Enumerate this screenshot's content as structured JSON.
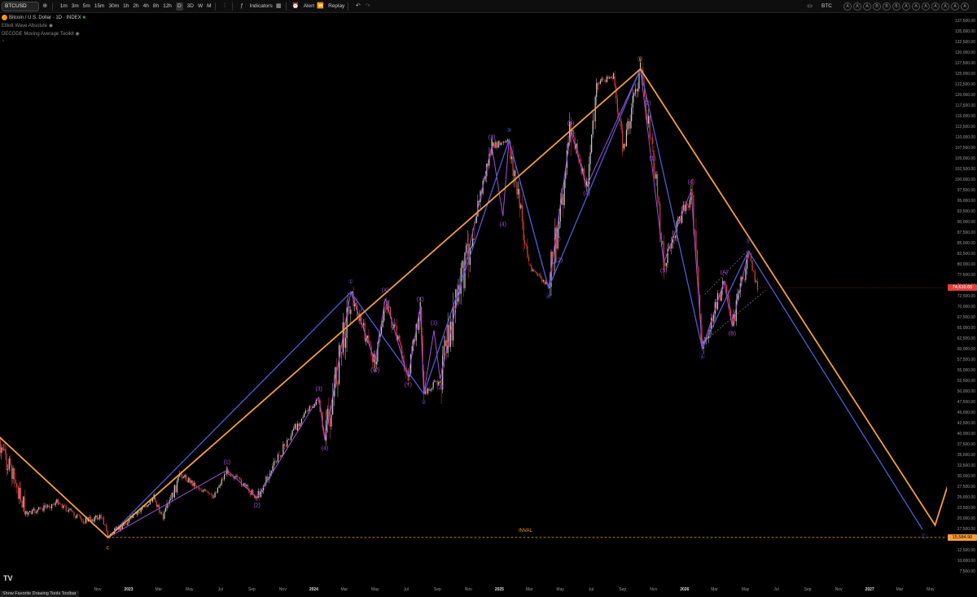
{
  "toolbar": {
    "symbol": "BTCUSD",
    "timeframes": [
      "1m",
      "3m",
      "5m",
      "15m",
      "30m",
      "1h",
      "2h",
      "4h",
      "8h",
      "12h",
      "D",
      "3D",
      "W",
      "M"
    ],
    "active_timeframe": "D",
    "indicators_label": "Indicators",
    "alert_label": "Alert",
    "replay_label": "Replay",
    "right_symbol": "BTC",
    "right_circles": [
      "A",
      "A",
      "A",
      "B",
      "B",
      "B",
      "A",
      "A",
      "A",
      "A",
      "A",
      "A",
      "A"
    ]
  },
  "legend": {
    "title": "Bitcoin / U.S. Dollar · 1D · INDEX",
    "line1": "Elliott Wave Absolute",
    "line2": "DECODE Moving Average Toolkit"
  },
  "colors": {
    "orange": "#f59e3b",
    "blue": "#4f5bd5",
    "purple": "#a64fd8",
    "up_candle": "#c8c8c8",
    "down_candle": "#e0413c",
    "current_price_bg": "#e0413c",
    "inval_bg": "#f59e3b"
  },
  "annotations": {
    "inval_label": "INVAL",
    "current_price": "74,610.66",
    "inval_price": "15,584.90",
    "status_text": "Show Favorite Drawing Tools Toolbar"
  },
  "chart_data": {
    "type": "line",
    "title": "Bitcoin / U.S. Dollar · 1D · INDEX",
    "xlabel": "",
    "ylabel": "",
    "ylim": [
      5000,
      140000
    ],
    "y_ticks": [
      7500,
      10000,
      12500,
      15000,
      17500,
      20000,
      22500,
      25000,
      27500,
      30000,
      32500,
      35000,
      37500,
      40000,
      42500,
      45000,
      47500,
      50000,
      52500,
      55000,
      57500,
      60000,
      62500,
      65000,
      67500,
      70000,
      72500,
      75000,
      77500,
      80000,
      82500,
      85000,
      87500,
      90000,
      92500,
      95000,
      97500,
      100000,
      102500,
      105000,
      107500,
      110000,
      112500,
      115000,
      117500,
      120000,
      122500,
      125000,
      127500,
      130000,
      132500,
      135000,
      137500
    ],
    "x_ticks": [
      {
        "date": "2022-11-01",
        "label": "Nov"
      },
      {
        "date": "2023-01-01",
        "label": "2023"
      },
      {
        "date": "2023-03-01",
        "label": "Mar"
      },
      {
        "date": "2023-05-01",
        "label": "May"
      },
      {
        "date": "2023-07-01",
        "label": "Jul"
      },
      {
        "date": "2023-09-01",
        "label": "Sep"
      },
      {
        "date": "2023-11-01",
        "label": "Nov"
      },
      {
        "date": "2024-01-01",
        "label": "2024"
      },
      {
        "date": "2024-03-01",
        "label": "Mar"
      },
      {
        "date": "2024-05-01",
        "label": "May"
      },
      {
        "date": "2024-07-01",
        "label": "Jul"
      },
      {
        "date": "2024-09-01",
        "label": "Sep"
      },
      {
        "date": "2024-11-01",
        "label": "Nov"
      },
      {
        "date": "2025-01-01",
        "label": "2025"
      },
      {
        "date": "2025-03-01",
        "label": "Mar"
      },
      {
        "date": "2025-05-01",
        "label": "May"
      },
      {
        "date": "2025-07-01",
        "label": "Jul"
      },
      {
        "date": "2025-09-01",
        "label": "Sep"
      },
      {
        "date": "2025-11-01",
        "label": "Nov"
      },
      {
        "date": "2026-01-01",
        "label": "2026"
      },
      {
        "date": "2026-03-01",
        "label": "Mar"
      },
      {
        "date": "2026-05-01",
        "label": "May"
      },
      {
        "date": "2026-07-01",
        "label": "Jul"
      },
      {
        "date": "2026-09-01",
        "label": "Sep"
      },
      {
        "date": "2026-11-01",
        "label": "Nov"
      },
      {
        "date": "2027-01-01",
        "label": "2027"
      },
      {
        "date": "2027-03-01",
        "label": "Mar"
      },
      {
        "date": "2027-05-01",
        "label": "May"
      }
    ],
    "series": [
      {
        "values": [
          {
            "x": "2022-03-01",
            "y": 43000
          },
          {
            "x": "2022-04-15",
            "y": 40000
          },
          {
            "x": "2022-06-15",
            "y": 21000
          },
          {
            "x": "2022-08-15",
            "y": 24000
          },
          {
            "x": "2022-10-01",
            "y": 19500
          },
          {
            "x": "2022-11-10",
            "y": 20500
          },
          {
            "x": "2022-11-21",
            "y": 15600
          },
          {
            "x": "2023-01-15",
            "y": 21000
          },
          {
            "x": "2023-02-20",
            "y": 25000
          },
          {
            "x": "2023-03-10",
            "y": 20000
          },
          {
            "x": "2023-04-14",
            "y": 30500
          },
          {
            "x": "2023-06-15",
            "y": 25000
          },
          {
            "x": "2023-07-14",
            "y": 31500
          },
          {
            "x": "2023-09-11",
            "y": 25000
          },
          {
            "x": "2023-10-25",
            "y": 35000
          },
          {
            "x": "2023-12-08",
            "y": 44000
          },
          {
            "x": "2024-01-11",
            "y": 48000
          },
          {
            "x": "2024-01-23",
            "y": 38500
          },
          {
            "x": "2024-03-14",
            "y": 73000
          },
          {
            "x": "2024-05-01",
            "y": 56500
          },
          {
            "x": "2024-05-21",
            "y": 71500
          },
          {
            "x": "2024-07-05",
            "y": 53500
          },
          {
            "x": "2024-07-29",
            "y": 70000
          },
          {
            "x": "2024-08-05",
            "y": 49500
          },
          {
            "x": "2024-09-06",
            "y": 53000
          },
          {
            "x": "2024-11-12",
            "y": 90000
          },
          {
            "x": "2024-12-17",
            "y": 108000
          },
          {
            "x": "2025-01-20",
            "y": 109000
          },
          {
            "x": "2025-02-28",
            "y": 80000
          },
          {
            "x": "2025-04-08",
            "y": 74500
          },
          {
            "x": "2025-05-22",
            "y": 111500
          },
          {
            "x": "2025-06-22",
            "y": 98500
          },
          {
            "x": "2025-07-14",
            "y": 123000
          },
          {
            "x": "2025-08-14",
            "y": 124500
          },
          {
            "x": "2025-09-01",
            "y": 107500
          },
          {
            "x": "2025-10-06",
            "y": 126200
          },
          {
            "x": "2025-10-30",
            "y": 107000
          },
          {
            "x": "2025-11-21",
            "y": 80500
          },
          {
            "x": "2026-01-14",
            "y": 97000
          },
          {
            "x": "2026-02-05",
            "y": 60200
          },
          {
            "x": "2026-03-20",
            "y": 76000
          },
          {
            "x": "2026-04-05",
            "y": 65500
          },
          {
            "x": "2026-05-07",
            "y": 82800
          },
          {
            "x": "2026-05-25",
            "y": 74610
          }
        ]
      }
    ]
  },
  "waves": {
    "orange": {
      "points": [
        {
          "x": "2022-03-01",
          "y": 45000
        },
        {
          "x": "2022-11-21",
          "y": 15600
        },
        {
          "x": "2025-10-06",
          "y": 126200
        },
        {
          "x": "2027-05-10",
          "y": 18500
        },
        {
          "x": "2027-06-15",
          "y": 32000
        }
      ],
      "labels": [
        {
          "text": "c",
          "x": "2022-11-21",
          "y": 13000
        },
        {
          "text": "Ⓑ",
          "x": "2025-10-06",
          "y": 128500
        }
      ]
    },
    "blue": {
      "points": [
        {
          "x": "2022-11-21",
          "y": 15600
        },
        {
          "x": "2024-03-14",
          "y": 73500
        },
        {
          "x": "2024-08-05",
          "y": 49500
        },
        {
          "x": "2025-01-20",
          "y": 109500
        },
        {
          "x": "2025-04-08",
          "y": 74500
        },
        {
          "x": "2025-10-06",
          "y": 126200
        },
        {
          "x": "2026-02-05",
          "y": 60200
        },
        {
          "x": "2026-05-07",
          "y": 83200
        },
        {
          "x": "2027-04-15",
          "y": 17500
        }
      ],
      "labels": [
        {
          "text": "①",
          "x": "2024-03-14",
          "y": 76000
        },
        {
          "text": "②",
          "x": "2024-08-05",
          "y": 47500
        },
        {
          "text": "③",
          "x": "2025-01-20",
          "y": 111800
        },
        {
          "text": "Ⓐ",
          "x": "2025-04-08",
          "y": 72500
        },
        {
          "text": "Ⓐ",
          "x": "2026-02-05",
          "y": 58200
        },
        {
          "text": "Ⓑ",
          "x": "2026-05-07",
          "y": 85500
        },
        {
          "text": "Ⓒ",
          "x": "2027-04-18",
          "y": 15800
        }
      ]
    },
    "purple": {
      "points": [
        {
          "x": "2022-11-21",
          "y": 15600
        },
        {
          "x": "2023-07-14",
          "y": 31500
        },
        {
          "x": "2023-09-11",
          "y": 25000
        },
        {
          "x": "2024-01-11",
          "y": 48700
        },
        {
          "x": "2024-01-23",
          "y": 38500
        },
        {
          "x": "2024-03-14",
          "y": 73500
        },
        {
          "x": "2024-05-01",
          "y": 57000
        },
        {
          "x": "2024-05-21",
          "y": 72000
        },
        {
          "x": "2024-07-05",
          "y": 53500
        },
        {
          "x": "2024-07-29",
          "y": 70000
        },
        {
          "x": "2024-08-05",
          "y": 49500
        },
        {
          "x": "2024-08-25",
          "y": 64500
        },
        {
          "x": "2024-09-06",
          "y": 53000
        },
        {
          "x": "2024-12-17",
          "y": 108000
        },
        {
          "x": "2025-01-08",
          "y": 91500
        },
        {
          "x": "2025-01-20",
          "y": 109500
        },
        {
          "x": "2025-04-08",
          "y": 74500
        },
        {
          "x": "2025-05-22",
          "y": 111500
        },
        {
          "x": "2025-06-22",
          "y": 98500
        },
        {
          "x": "2025-10-06",
          "y": 126200
        },
        {
          "x": "2025-11-21",
          "y": 80500
        },
        {
          "x": "2026-01-14",
          "y": 97500
        },
        {
          "x": "2026-02-05",
          "y": 60200
        },
        {
          "x": "2026-03-20",
          "y": 76000
        },
        {
          "x": "2026-04-05",
          "y": 65500
        },
        {
          "x": "2026-05-07",
          "y": 83200
        }
      ],
      "labels": [
        {
          "text": "(1)",
          "x": "2023-07-14",
          "y": 33200
        },
        {
          "text": "(2)",
          "x": "2023-09-11",
          "y": 23000
        },
        {
          "text": "(3)",
          "x": "2024-01-11",
          "y": 50500
        },
        {
          "text": "(4)",
          "x": "2024-01-23",
          "y": 36500
        },
        {
          "text": "(W)",
          "x": "2024-05-01",
          "y": 55000
        },
        {
          "text": "(X)",
          "x": "2024-05-21",
          "y": 73800
        },
        {
          "text": "(Y)",
          "x": "2024-07-05",
          "y": 51500
        },
        {
          "text": "(X)",
          "x": "2024-07-29",
          "y": 71800
        },
        {
          "text": "(1)",
          "x": "2024-08-25",
          "y": 66200
        },
        {
          "text": "(2)",
          "x": "2024-09-06",
          "y": 51000
        },
        {
          "text": "(3)",
          "x": "2024-12-17",
          "y": 110000
        },
        {
          "text": "(4)",
          "x": "2025-01-08",
          "y": 89500
        },
        {
          "text": "(1)",
          "x": "2025-04-25",
          "y": 86000
        },
        {
          "text": "(2)",
          "x": "2025-04-29",
          "y": 81000
        },
        {
          "text": "(3)",
          "x": "2025-05-22",
          "y": 113300
        },
        {
          "text": "(4)",
          "x": "2025-06-22",
          "y": 96800
        },
        {
          "text": "(2)",
          "x": "2025-10-20",
          "y": 118000
        },
        {
          "text": "(1)",
          "x": "2025-10-30",
          "y": 105000
        },
        {
          "text": "(3)",
          "x": "2025-11-21",
          "y": 78500
        },
        {
          "text": "(4)",
          "x": "2026-01-14",
          "y": 99500
        },
        {
          "text": "(A)",
          "x": "2026-03-20",
          "y": 78000
        },
        {
          "text": "(B)",
          "x": "2026-04-05",
          "y": 63600
        }
      ]
    }
  }
}
